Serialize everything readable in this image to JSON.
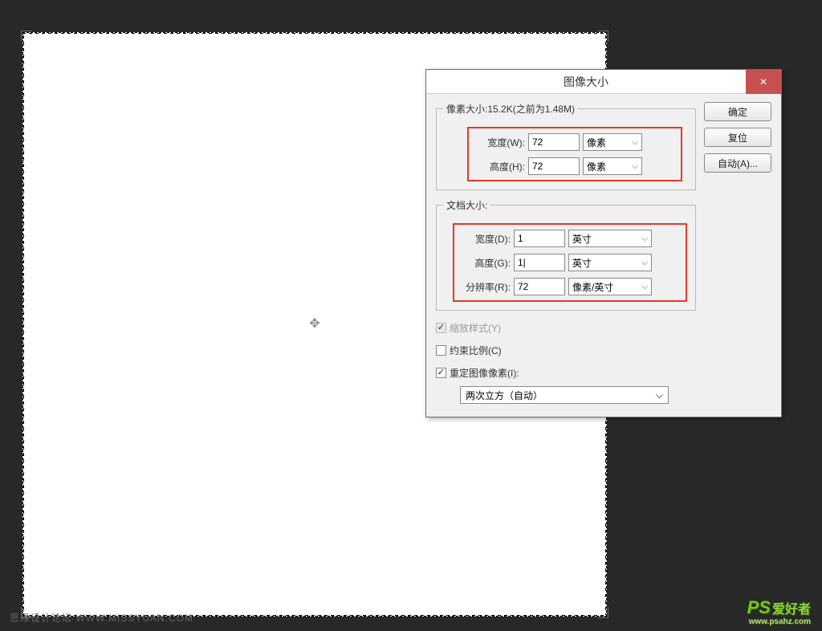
{
  "canvas": {
    "center_glyph": "✥"
  },
  "dialog": {
    "title": "图像大小",
    "pixel_legend": "像素大小:15.2K(之前为1.48M)",
    "width_label": "宽度(W):",
    "height_label": "高度(H):",
    "width_val": "72",
    "height_val": "72",
    "unit_px": "像素",
    "doc_legend": "文档大小:",
    "doc_width_label": "宽度(D):",
    "doc_height_label": "高度(G):",
    "res_label": "分辨率(R):",
    "doc_width_val": "1",
    "doc_height_val": "1|",
    "res_val": "72",
    "unit_inch": "英寸",
    "unit_ppi": "像素/英寸",
    "scale_styles": "缩放样式(Y)",
    "constrain": "约束比例(C)",
    "resample": "重定图像像素(I):",
    "resample_method": "两次立方（自动）",
    "ok": "确定",
    "reset": "复位",
    "auto": "自动(A)..."
  },
  "watermark": {
    "left": "思缘设计论坛 WWW.MISSYUAN.COM",
    "right_ps": "PS",
    "right_cn": "爱好者",
    "right_url": "www.psahz.com"
  }
}
